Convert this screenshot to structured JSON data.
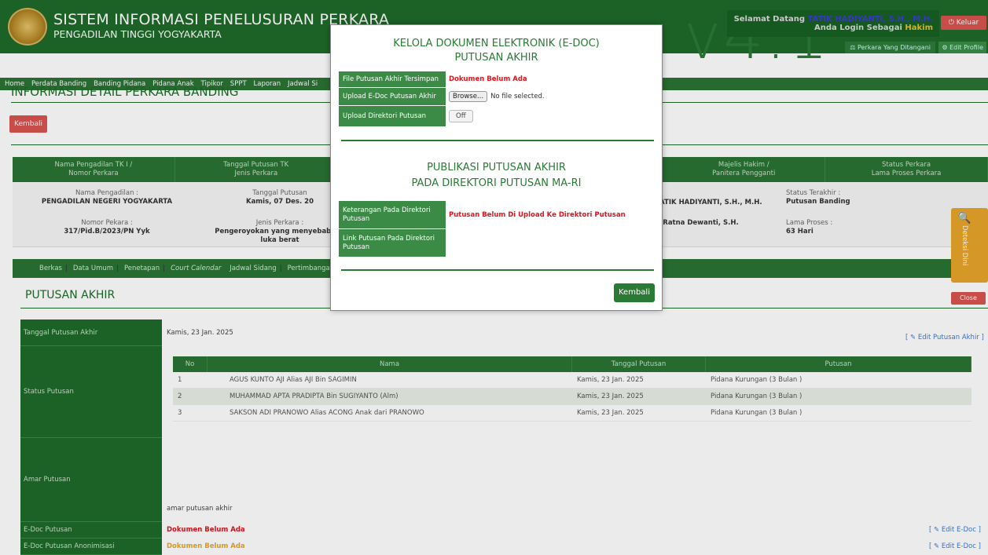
{
  "header": {
    "title": "SISTEM INFORMASI PENELUSURAN PERKARA",
    "subtitle": "PENGADILAN TINGGI YOGYAKARTA",
    "watermark": "v4.1",
    "welcome_prefix": "Selamat Datang",
    "user_name": "TATIK HADIYANTI, S.H., M.H.",
    "login_as": "Anda Login Sebagai",
    "role": "Hakim",
    "logout_label": "Keluar",
    "handled_cases_label": "Perkara Yang Ditangani",
    "edit_profile_label": "Edit Profile"
  },
  "nav": {
    "items": [
      "Home",
      "Perdata Banding",
      "Banding Pidana",
      "Pidana Anak",
      "Tipikor",
      "SPPT",
      "Laporan",
      "Jadwal Si"
    ]
  },
  "page": {
    "title": "INFORMASI DETAIL PERKARA BANDING",
    "back_label": "Kembali"
  },
  "info": {
    "headers": [
      "Nama Pengadilan TK I /\nNomor Perkara",
      "Tanggal Putusan TK\nJenis Perkara",
      "",
      "",
      "Majelis Hakim /\nPanitera Pengganti",
      "Status Perkara\nLama Proses Perkara"
    ],
    "court_label": "Nama Pengadilan :",
    "court_value": "PENGADILAN NEGERI YOGYAKARTA",
    "case_no_label": "Nomor Pekara :",
    "case_no_value": "317/Pid.B/2023/PN Yyk",
    "decision_date_label": "Tanggal Putusan",
    "decision_date_value": "Kamis, 07 Des. 20",
    "case_type_label": "Jenis Perkara :",
    "case_type_value": "Pengeroyokan yang menyebabkan luka berat",
    "judge_value": "TATIK HADIYANTI, S.H., M.H.",
    "clerk_value": "i: Ratna Dewanti, S.H.",
    "status_label": "Status Terakhir :",
    "status_value": "Putusan Banding",
    "duration_label": "Lama Proses :",
    "duration_value": "63 Hari"
  },
  "tabs": {
    "items": [
      "Berkas",
      "Data Umum",
      "Penetapan",
      "Court Calendar",
      "Jadwal Sidang",
      "Pertimbangan H"
    ]
  },
  "section": {
    "title": "PUTUSAN AKHIR",
    "close_label": "Close"
  },
  "detection": {
    "label": "Deteksi Dini"
  },
  "details": {
    "date_label": "Tanggal Putusan Akhir",
    "date_value": "Kamis, 23 Jan. 2025",
    "edit_putusan_label": "[ ✎ Edit Putusan Akhir ]",
    "status_label": "Status Putusan",
    "amar_label": "Amar Putusan",
    "amar_value": "amar putusan akhir",
    "edoc_label": "E-Doc Putusan",
    "edoc_value": "Dokumen Belum Ada",
    "edoc_anon_label": "E-Doc Putusan Anonimisasi",
    "edoc_anon_value": "Dokumen Belum Ada",
    "edit_edoc_label": "[ ✎ Edit E-Doc ]"
  },
  "verdict_table": {
    "headers": [
      "No",
      "Nama",
      "Tanggal Putusan",
      "Putusan"
    ],
    "rows": [
      [
        "1",
        "AGUS KUNTO AJI Alias AJI Bin SAGIMIN",
        "Kamis, 23 Jan. 2025",
        "Pidana Kurungan (3 Bulan )"
      ],
      [
        "2",
        "MUHAMMAD APTA PRADIPTA Bin SUGIYANTO (Alm)",
        "Kamis, 23 Jan. 2025",
        "Pidana Kurungan (3 Bulan )"
      ],
      [
        "3",
        "SAKSON ADI PRANOWO Alias ACONG Anak dari PRANOWO",
        "Kamis, 23 Jan. 2025",
        "Pidana Kurungan (3 Bulan )"
      ]
    ]
  },
  "modal": {
    "title1": "KELOLA DOKUMEN ELEKTRONIK (E-DOC)",
    "title2": "PUTUSAN AKHIR",
    "saved_label": "File Putusan Akhir Tersimpan",
    "saved_value": "Dokumen Belum Ada",
    "upload_label": "Upload E-Doc Putusan Akhir",
    "browse_label": "Browse...",
    "no_file": "No file selected.",
    "upload_dir_label": "Upload Direktori Putusan",
    "toggle_label": "Off",
    "pub_title1": "PUBLIKASI PUTUSAN AKHIR",
    "pub_title2": "PADA DIREKTORI PUTUSAN MA-RI",
    "note_label": "Keterangan Pada Direktori Putusan",
    "note_value": "Putusan Belum Di Upload Ke Direktori Putusan",
    "link_label": "Link Putusan Pada Direktori Putusan",
    "back_label": "Kembali"
  }
}
